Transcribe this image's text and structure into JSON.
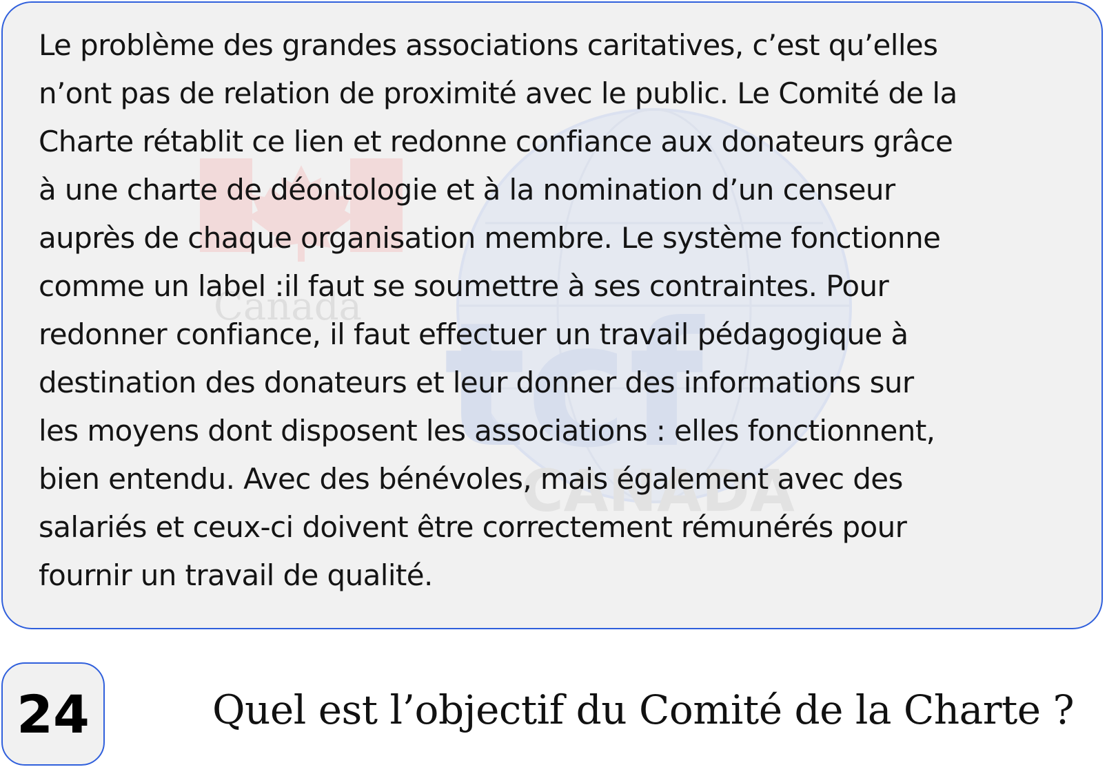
{
  "passage": {
    "text": "Le problème des grandes associations caritatives, c’est qu’elles\nn’ont pas de relation de proximité avec le public. Le Comité de la\nCharte rétablit ce lien et redonne confiance aux donateurs grâce\nà une charte de déontologie et à la nomination d’un censeur\nauprès de chaque organisation membre. Le système fonctionne\ncomme un label :il faut se soumettre à ses contraintes. Pour\nredonner confiance, il faut effectuer un travail pédagogique à\ndestination des donateurs et leur donner des informations sur\nles moyens dont disposent les associations : elles fonctionnent,\nbien entendu. Avec des bénévoles, mais également avec des\nsalariés et ceux-ci doivent être correctement rémunérés pour\nfournir un travail de qualité."
  },
  "watermark": {
    "left_logo_text": "Canada",
    "right_logo_text": "CANADA",
    "right_logo_letters": "tcf"
  },
  "question": {
    "number": "24",
    "text": "Quel est l’objectif du Comité de la Charte ?"
  },
  "colors": {
    "border": "#2f5fdc",
    "box_background": "#f1f1f1",
    "watermark_red": "#f3c9c9",
    "watermark_blue": "#dfe5f2"
  }
}
